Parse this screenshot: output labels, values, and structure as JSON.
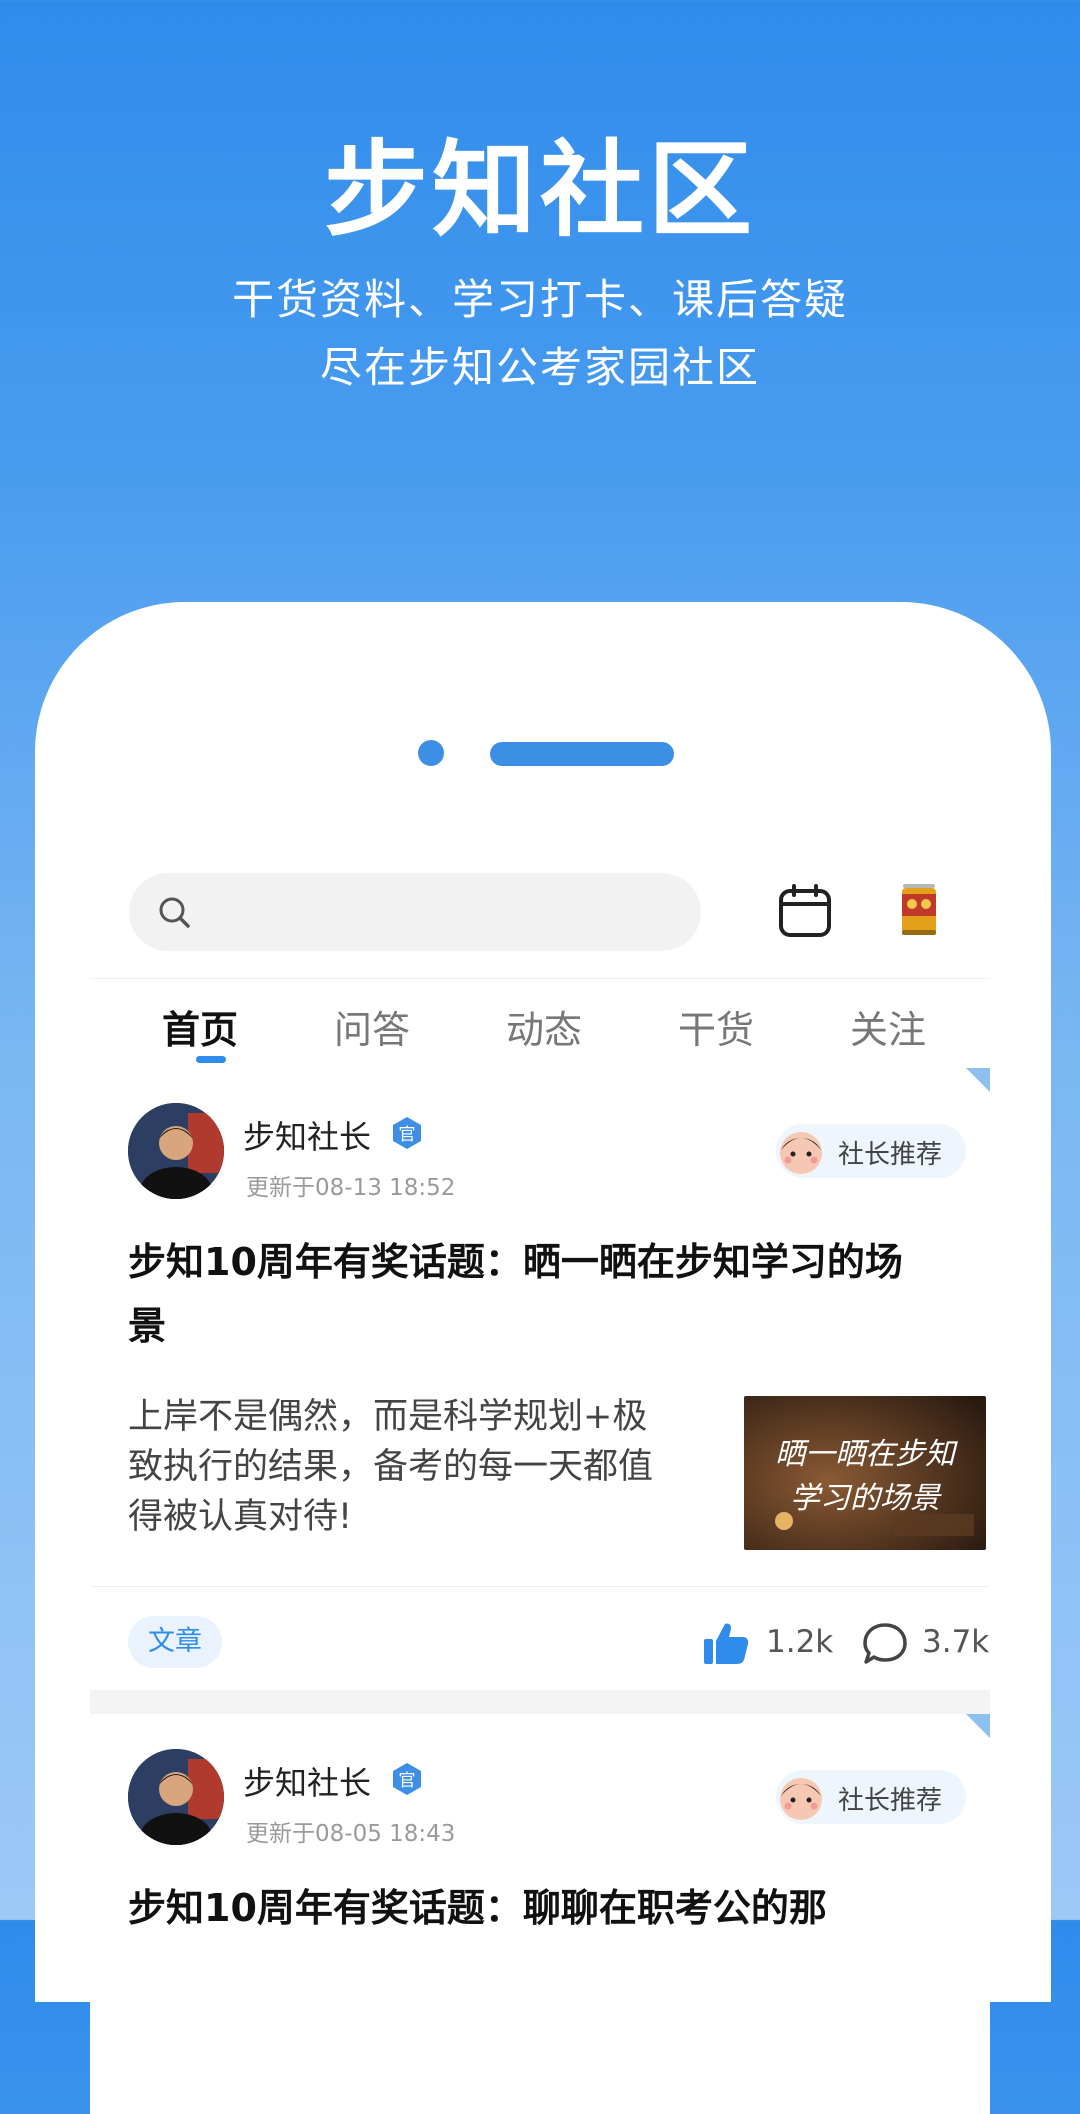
{
  "hero": {
    "title": "步知社区",
    "subtitle_line1": "干货资料、学习打卡、课后答疑",
    "subtitle_line2": "尽在步知公考家园社区"
  },
  "search": {
    "placeholder": ""
  },
  "tabs": [
    {
      "label": "首页",
      "active": true
    },
    {
      "label": "问答",
      "active": false
    },
    {
      "label": "动态",
      "active": false
    },
    {
      "label": "干货",
      "active": false
    },
    {
      "label": "关注",
      "active": false
    }
  ],
  "posts": [
    {
      "author": "步知社长",
      "updated": "更新于08-13 18:52",
      "badge": "社长推荐",
      "title": "步知10周年有奖话题：晒一晒在步知学习的场景",
      "excerpt": "上岸不是偶然，而是科学规划+极致执行的结果，备考的每一天都值得被认真对待!",
      "thumb_text_line1": "晒一晒在步知",
      "thumb_text_line2": "学习的场景",
      "tag": "文章",
      "likes": "1.2k",
      "comments": "3.7k"
    },
    {
      "author": "步知社长",
      "updated": "更新于08-05 18:43",
      "badge": "社长推荐",
      "title": "步知10周年有奖话题：聊聊在职考公的那"
    }
  ],
  "colors": {
    "accent": "#2f8ceb",
    "hero_bg_top": "#2f8ceb",
    "hero_bg_bottom": "#9cc9f6"
  }
}
